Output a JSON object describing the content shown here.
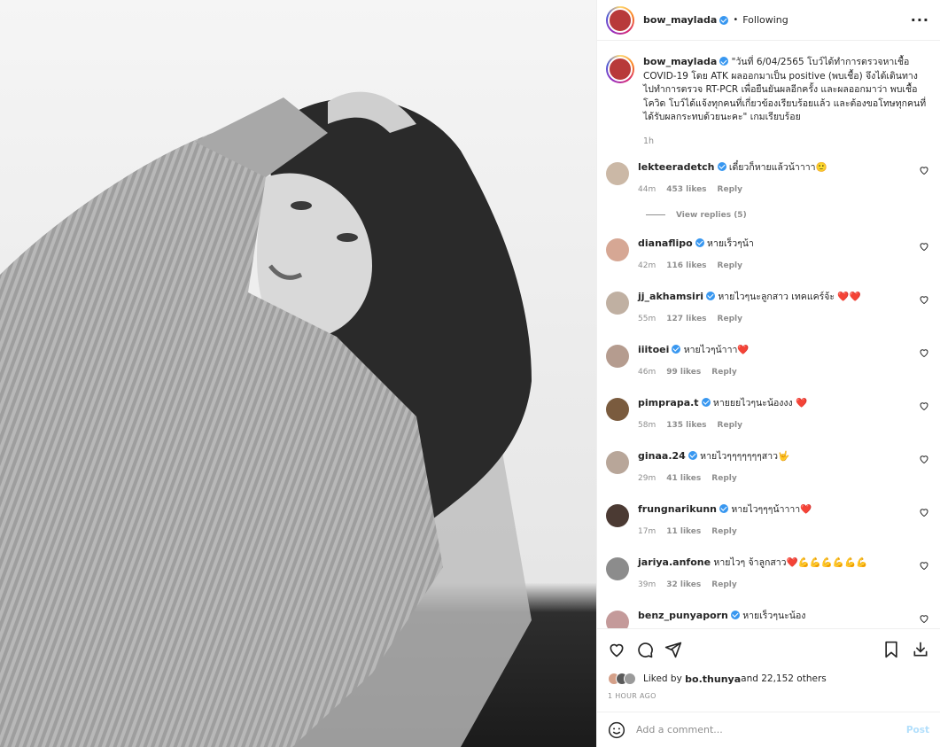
{
  "post": {
    "author": "bow_maylada",
    "separator": "•",
    "follow_status": "Following",
    "caption": "\"วันที่ 6/04/2565 โบว์ได้ทำการตรวจหาเชื้อ COVID-19 โดย ATK ผลออกมาเป็น positive (พบเชื้อ) จึงได้เดินทางไปทำการตรวจ RT-PCR เพื่อยืนยันผลอีกครั้ง และผลออกมาว่า พบเชื้อโควิด โบว์ได้แจ้งทุกคนที่เกี่ยวข้องเรียบร้อยแล้ว และต้องขอโทษทุกคนที่ได้รับผลกระทบด้วยนะคะ\" เกมเรียบร้อย",
    "caption_age": "1h"
  },
  "comments": [
    {
      "user": "lekteeradetch",
      "text": "เดี๋ยวก็หายแล้วน้าาาา🙂",
      "age": "44m",
      "likes": "453 likes",
      "reply": "Reply",
      "av": "#cbb8a6"
    },
    {
      "user": "dianaflipo",
      "text": "หายเร็วๆน้า",
      "age": "42m",
      "likes": "116 likes",
      "reply": "Reply",
      "av": "#d6a794"
    },
    {
      "user": "jj_akhamsiri",
      "text": "หายไวๆนะลูกสาว เทคแคร์จ้ะ ❤️❤️",
      "age": "55m",
      "likes": "127 likes",
      "reply": "Reply",
      "av": "#c0b0a2"
    },
    {
      "user": "iiitoei",
      "text": "หายไวๆน้าาา❤️",
      "age": "46m",
      "likes": "99 likes",
      "reply": "Reply",
      "av": "#b59c8f"
    },
    {
      "user": "pimprapa.t",
      "text": "หายยยไวๆนะน้องงง ❤️",
      "age": "58m",
      "likes": "135 likes",
      "reply": "Reply",
      "av": "#7a5b3e"
    },
    {
      "user": "ginaa.24",
      "text": "หายไวๆๆๆๆๆๆๆสาว🤟",
      "age": "29m",
      "likes": "41 likes",
      "reply": "Reply",
      "av": "#b8a699"
    },
    {
      "user": "frungnarikunn",
      "text": "หายไวๆๆๆน้าาาา❤️",
      "age": "17m",
      "likes": "11 likes",
      "reply": "Reply",
      "av": "#4b3a33"
    },
    {
      "user": "jariya.anfone",
      "text": "หายไวๆ จ้าลูกสาว❤️💪💪💪💪💪💪",
      "age": "39m",
      "likes": "32 likes",
      "reply": "Reply",
      "av": "#8c8c8c"
    },
    {
      "user": "benz_punyaporn",
      "text": "หายเร็วๆนะน้อง",
      "age": "",
      "likes": "",
      "reply": "",
      "av": "#c49a9a"
    }
  ],
  "view_replies": "View replies (5)",
  "likes_line": {
    "prefix": "Liked by ",
    "user": "bo.thunya",
    "suffix": " and 22,152 others"
  },
  "timestamp": "1 HOUR AGO",
  "composer": {
    "placeholder": "Add a comment...",
    "post_label": "Post"
  },
  "icons": [
    "heart-icon",
    "comment-icon",
    "share-icon",
    "bookmark-icon",
    "download-icon",
    "emoji-icon",
    "more-icon"
  ]
}
